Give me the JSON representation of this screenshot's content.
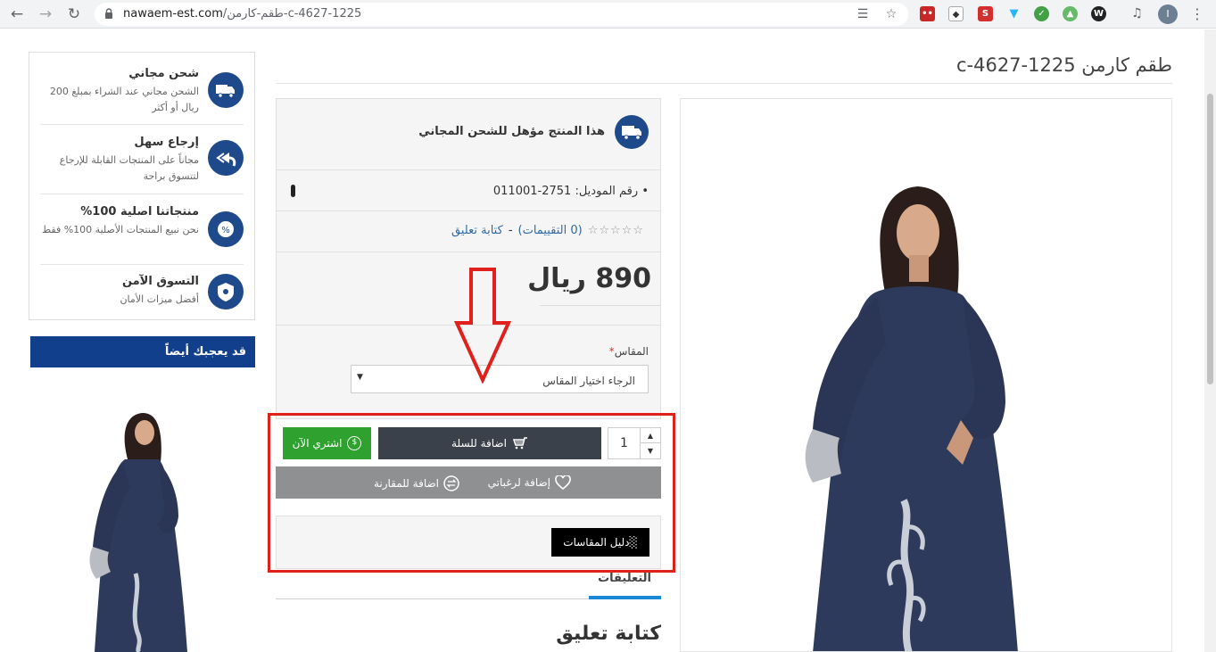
{
  "browser": {
    "url_domain": "nawaem-est.com",
    "url_path": "/طقم-كارمن-c-4627-1225",
    "profile_initial": "I"
  },
  "product": {
    "title": "طقم كارمن c-4627-1225",
    "free_shipping_notice": "هذا المنتج مؤهل للشحن المجاني",
    "model_label": "رقم الموديل: 2751-011001",
    "ratings_count_text": "(0 التقييمات)",
    "rating_value": 0,
    "rating_max": 5,
    "separator": "-",
    "write_review_link": "كتابة تعليق",
    "price": "890 ريال",
    "size": {
      "label": "المقاس",
      "required_mark": "*",
      "placeholder": "الرجاء اختيار المقاس"
    }
  },
  "actions": {
    "quantity": "1",
    "add_to_cart": "اضافة للسلة",
    "buy_now": "اشتري الآن",
    "add_to_wishlist": "إضافة لرغباتي",
    "add_to_compare": "اضافة للمقارنة",
    "size_guide": "دليل المقاسات"
  },
  "tabs": {
    "reviews_tab": "التعليقات",
    "write_review_heading": "كتابة تعليق"
  },
  "sidebar": {
    "features": [
      {
        "icon": "truck-icon",
        "title": "شحن مجاني",
        "desc": "الشحن مجاني عند الشراء بمبلغ 200 ريال أو أكثر"
      },
      {
        "icon": "return-arrow-icon",
        "title": "إرجاع سهل",
        "desc": "مجاناً على المنتجات القابلة للإرجاع لتتسوق براحة"
      },
      {
        "icon": "percent-icon",
        "title": "منتجاتنا اصلية 100%",
        "desc": "نحن نبيع المنتجات الأصلية 100% فقط"
      },
      {
        "icon": "shield-badge-icon",
        "title": "التسوق الآمن",
        "desc": "أفضل ميزات الأمان"
      }
    ],
    "also_like_heading": "قد يعجبك أيضاً"
  },
  "colors": {
    "brand_blue": "#113f8c",
    "cart_button": "#3a414b",
    "buy_button": "#2ea12e",
    "highlight_red": "#e0211b"
  }
}
